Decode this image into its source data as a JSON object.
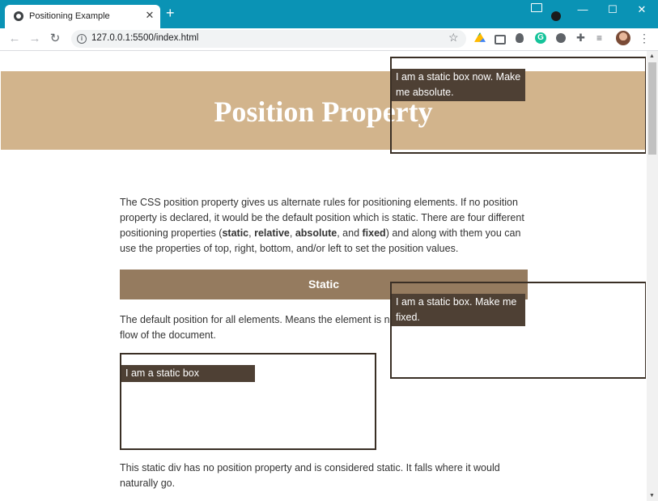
{
  "browser": {
    "tab_title": "Positioning Example",
    "tab_close": "✕",
    "new_tab": "+",
    "url": "127.0.0.1:5500/index.html",
    "nav": {
      "back": "←",
      "forward": "→",
      "reload": "↻"
    },
    "window_controls": {
      "minimize": "—",
      "maximize": "☐",
      "close": "✕"
    },
    "menu": "⋮",
    "star": "☆",
    "info": "i"
  },
  "page": {
    "title": "Position Property",
    "intro": [
      "The CSS position property gives us alternate rules for positioning elements. If no position property is declared, it would be the default position which is static. There are four different positioning properties (",
      "static",
      ", ",
      "relative",
      ", ",
      "absolute",
      ", and ",
      "fixed",
      ") and along with them you can use the properties of top, right, bottom, and/or left to set the position values."
    ],
    "static_heading": "Static",
    "static_desc": "The default position for all elements. Means the element is not positioned in the natural flow of the document.",
    "static_box_label": "I am a static box",
    "static_note": "This static div has no position property and is considered static. It falls where it would naturally go.",
    "absolute_box_label": "I am a static box now. Make me absolute.",
    "fixed_box_label": "I am a static box. Make me fixed."
  },
  "colors": {
    "titlebar": "#0a93b5",
    "banner": "#d2b48c",
    "section_bar": "#957b5f",
    "box_label": "#4e4034",
    "box_border": "#3a2f25"
  }
}
